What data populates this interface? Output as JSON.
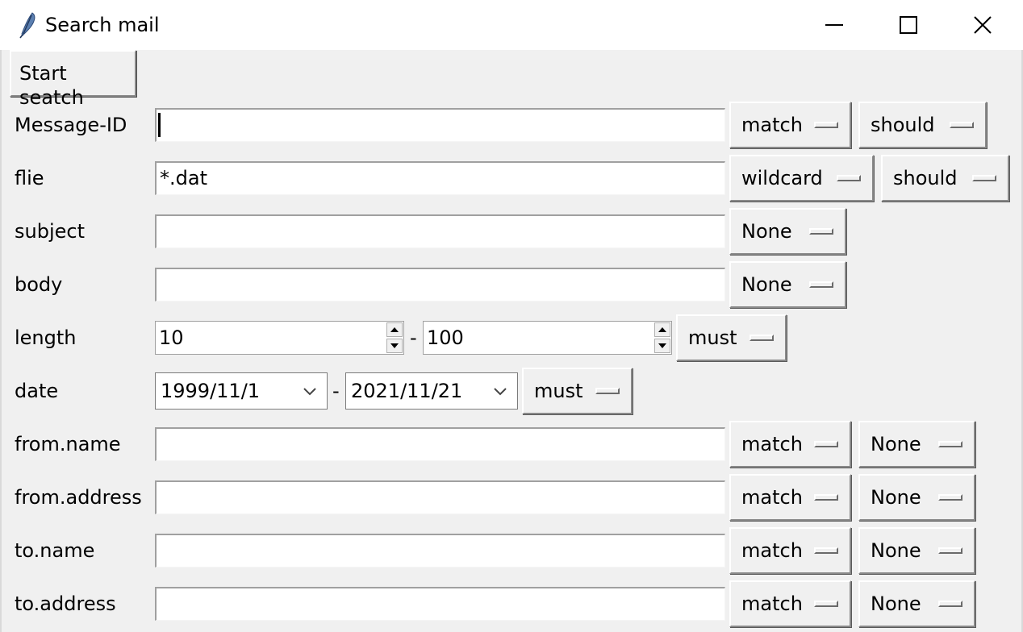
{
  "window": {
    "title": "Search mail"
  },
  "toolbar": {
    "start_label": "Start seatch"
  },
  "fields": {
    "message_id": {
      "label": "Message-ID",
      "value": "",
      "mode": "match",
      "occur": "should"
    },
    "file": {
      "label": "flie",
      "value": "*.dat",
      "mode": "wildcard",
      "occur": "should"
    },
    "subject": {
      "label": "subject",
      "value": "",
      "occur": "None"
    },
    "body": {
      "label": "body",
      "value": "",
      "occur": "None"
    },
    "length": {
      "label": "length",
      "min": "10",
      "separator": "-",
      "max": "100",
      "occur": "must"
    },
    "date": {
      "label": "date",
      "from": "1999/11/1",
      "separator": "-",
      "to": "2021/11/21",
      "occur": "must"
    },
    "from_name": {
      "label": "from.name",
      "value": "",
      "mode": "match",
      "occur": "None"
    },
    "from_address": {
      "label": "from.address",
      "value": "",
      "mode": "match",
      "occur": "None"
    },
    "to_name": {
      "label": "to.name",
      "value": "",
      "mode": "match",
      "occur": "None"
    },
    "to_address": {
      "label": "to.address",
      "value": "",
      "mode": "match",
      "occur": "None"
    }
  },
  "icons": {
    "app": "feather-icon",
    "minimize": "minimize-icon",
    "maximize": "maximize-icon",
    "close": "close-icon"
  }
}
